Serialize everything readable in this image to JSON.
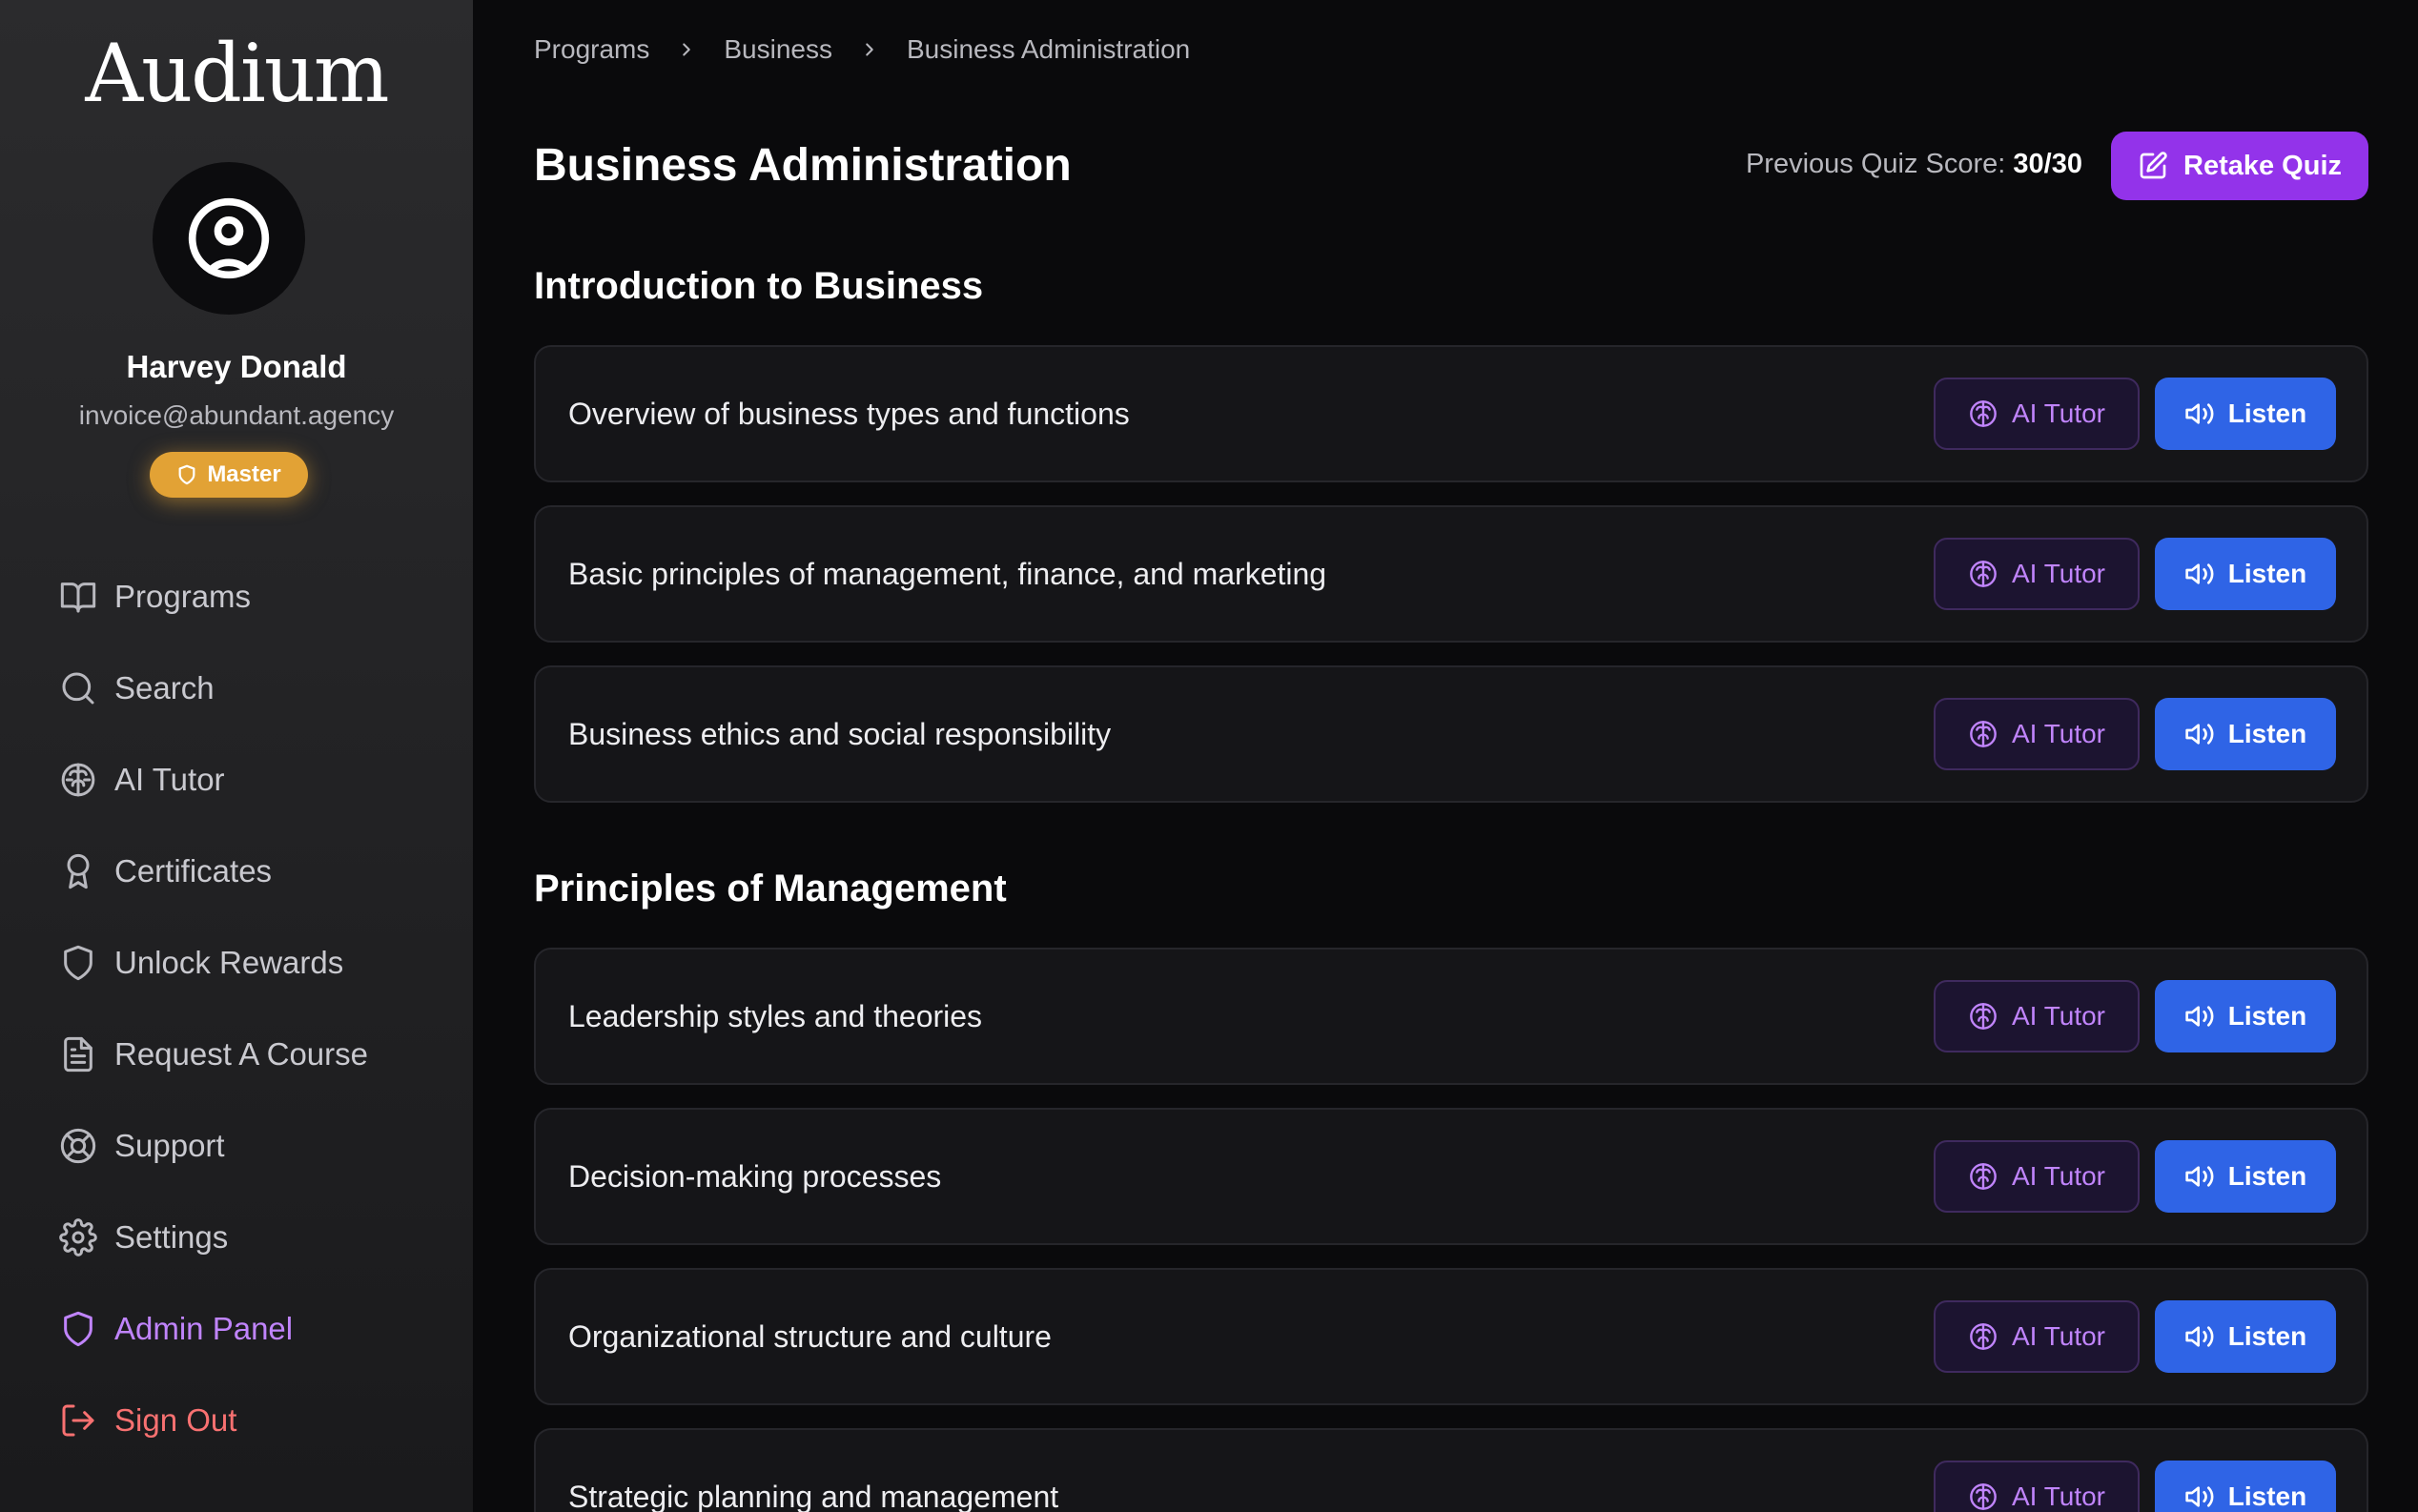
{
  "app": {
    "logo": "Audium"
  },
  "user": {
    "name": "Harvey Donald",
    "email": "invoice@abundant.agency",
    "badge": "Master"
  },
  "nav": {
    "items": [
      {
        "label": "Programs",
        "icon": "book-open-icon"
      },
      {
        "label": "Search",
        "icon": "search-icon"
      },
      {
        "label": "AI Tutor",
        "icon": "brain-icon"
      },
      {
        "label": "Certificates",
        "icon": "award-icon"
      },
      {
        "label": "Unlock Rewards",
        "icon": "shield-icon"
      },
      {
        "label": "Request A Course",
        "icon": "file-text-icon"
      },
      {
        "label": "Support",
        "icon": "life-buoy-icon"
      },
      {
        "label": "Settings",
        "icon": "gear-icon"
      },
      {
        "label": "Admin Panel",
        "icon": "shield-icon"
      },
      {
        "label": "Sign Out",
        "icon": "log-out-icon"
      }
    ]
  },
  "breadcrumb": [
    "Programs",
    "Business",
    "Business Administration"
  ],
  "page": {
    "title": "Business Administration",
    "quiz_score_label": "Previous Quiz Score:",
    "quiz_score_value": "30/30",
    "retake_label": "Retake Quiz"
  },
  "buttons": {
    "ai_tutor": "AI Tutor",
    "listen": "Listen"
  },
  "sections": [
    {
      "title": "Introduction to Business",
      "topics": [
        "Overview of business types and functions",
        "Basic principles of management, finance, and marketing",
        "Business ethics and social responsibility"
      ]
    },
    {
      "title": "Principles of Management",
      "topics": [
        "Leadership styles and theories",
        "Decision-making processes",
        "Organizational structure and culture",
        "Strategic planning and management"
      ]
    }
  ],
  "colors": {
    "accent_purple": "#9333ea",
    "listen_blue": "#2f64e6",
    "badge_gold": "#e2a235",
    "admin_purple": "#c084fc",
    "signout_red": "#f87171"
  }
}
